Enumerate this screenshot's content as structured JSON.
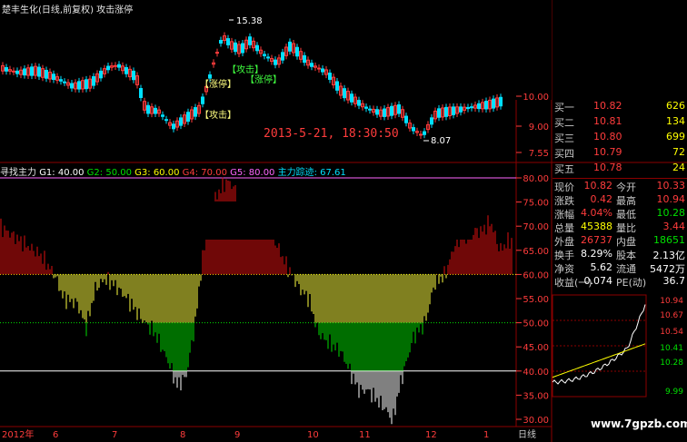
{
  "title": "楚丰生化(日线,前复权) 攻击涨停",
  "indicator_line": {
    "name": "寻找主力",
    "g1": "G1: 40.00",
    "g2": "G2: 50.00",
    "g3": "G3: 60.00",
    "g4": "G4: 70.00",
    "g5": "G5: 80.00",
    "force": "主力踪迹: 67.61"
  },
  "colors": {
    "g1": "#ffffff",
    "g2": "#00e000",
    "g3": "#ffff00",
    "g4": "#ff3c3c",
    "g5": "#ff66ff",
    "force": "#00e0ff"
  },
  "annotations": {
    "high": "15.38",
    "low": "8.07",
    "attack": "攻击",
    "limit_up_1": "涨停",
    "limit_up_2": "涨停",
    "attack_2": "攻击",
    "timestamp": "2013-5-21, 18:30:50"
  },
  "price_axis": [
    "10.00",
    "9.00",
    "7.55"
  ],
  "ind_axis": [
    "80.00",
    "75.00",
    "70.00",
    "65.00",
    "60.00",
    "55.00",
    "50.00",
    "45.00",
    "40.00",
    "35.00",
    "30.00"
  ],
  "x_axis": [
    "2012年",
    "6",
    "7",
    "8",
    "9",
    "10",
    "11",
    "12",
    "1"
  ],
  "x_axis_tail": "日线",
  "quote": {
    "bids": [
      {
        "label": "买一",
        "price": "10.82",
        "vol": "626"
      },
      {
        "label": "买二",
        "price": "10.81",
        "vol": "134"
      },
      {
        "label": "买三",
        "price": "10.80",
        "vol": "699"
      },
      {
        "label": "买四",
        "price": "10.79",
        "vol": "72"
      },
      {
        "label": "买五",
        "price": "10.78",
        "vol": "24"
      }
    ],
    "rows": [
      {
        "l1": "现价",
        "v1": "10.82",
        "l2": "今开",
        "v2": "10.33",
        "c1": "red",
        "c2": "red"
      },
      {
        "l1": "涨跌",
        "v1": "0.42",
        "l2": "最高",
        "v2": "10.94",
        "c1": "red",
        "c2": "red"
      },
      {
        "l1": "涨幅",
        "v1": "4.04%",
        "l2": "最低",
        "v2": "10.28",
        "c1": "red",
        "c2": "green"
      },
      {
        "l1": "总量",
        "v1": "45388",
        "l2": "量比",
        "v2": "3.44",
        "c1": "yellow",
        "c2": "red"
      },
      {
        "l1": "外盘",
        "v1": "26737",
        "l2": "内盘",
        "v2": "18651",
        "c1": "red",
        "c2": "green"
      },
      {
        "l1": "换手",
        "v1": "8.29%",
        "l2": "股本",
        "v2": "2.13亿",
        "c1": "white",
        "c2": "white"
      },
      {
        "l1": "净资",
        "v1": "5.62",
        "l2": "流通",
        "v2": "5472万",
        "c1": "white",
        "c2": "white"
      },
      {
        "l1": "收益(一)",
        "v1": "0.074",
        "l2": "PE(动)",
        "v2": "36.7",
        "c1": "white",
        "c2": "white"
      }
    ]
  },
  "mini_axis": [
    "10.94",
    "10.67",
    "10.54",
    "10.41",
    "10.28",
    "9.99"
  ],
  "watermark": "www.7gpzb.com"
}
